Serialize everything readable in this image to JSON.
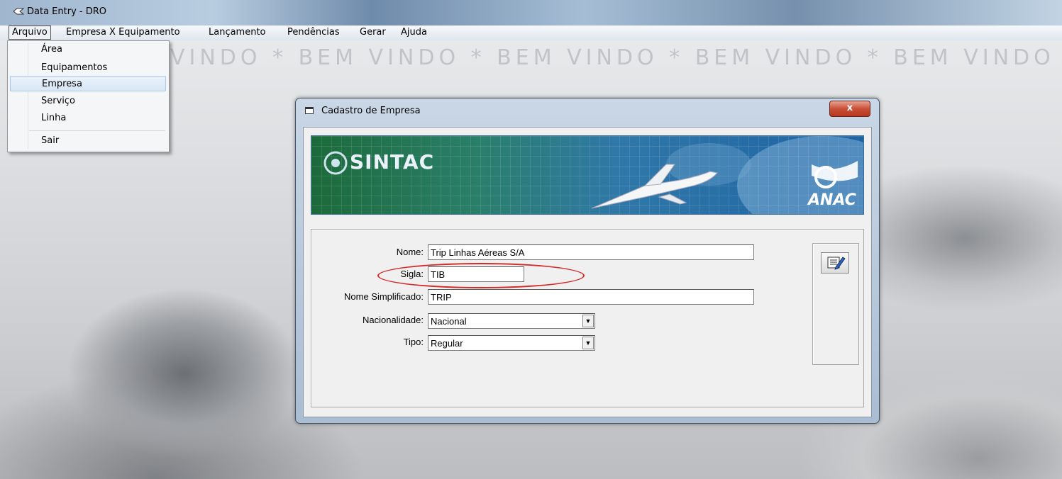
{
  "window": {
    "title": "Data Entry - DRO"
  },
  "menubar": {
    "items": [
      "Arquivo",
      "Empresa X Equipamento",
      "Lançamento",
      "Pendências",
      "Gerar",
      "Ajuda"
    ]
  },
  "arquivo_menu": {
    "items": [
      "Área",
      "Equipamentos",
      "Empresa",
      "Serviço",
      "Linha",
      "Sair"
    ],
    "highlighted": "Empresa"
  },
  "background": {
    "banner_text": "VINDO * BEM VINDO * BEM VINDO * BEM VINDO * BEM VINDO"
  },
  "dialog": {
    "title": "Cadastro de Empresa",
    "close_label": "x",
    "banner": {
      "brand": "SINTAC",
      "agency": "ANAC"
    },
    "form": {
      "nome": {
        "label": "Nome:",
        "value": "Trip Linhas Aéreas S/A"
      },
      "sigla": {
        "label": "Sigla:",
        "value": "TIB"
      },
      "nome_simplificado": {
        "label": "Nome Simplificado:",
        "value": "TRIP"
      },
      "nacionalidade": {
        "label": "Nacionalidade:",
        "value": "Nacional"
      },
      "tipo": {
        "label": "Tipo:",
        "value": "Regular"
      }
    },
    "edit_button_icon": "edit-form-icon"
  },
  "colors": {
    "highlight_ellipse": "#d42a2a",
    "banner_blue": "#1f5f9a",
    "close_red": "#c94f36"
  }
}
